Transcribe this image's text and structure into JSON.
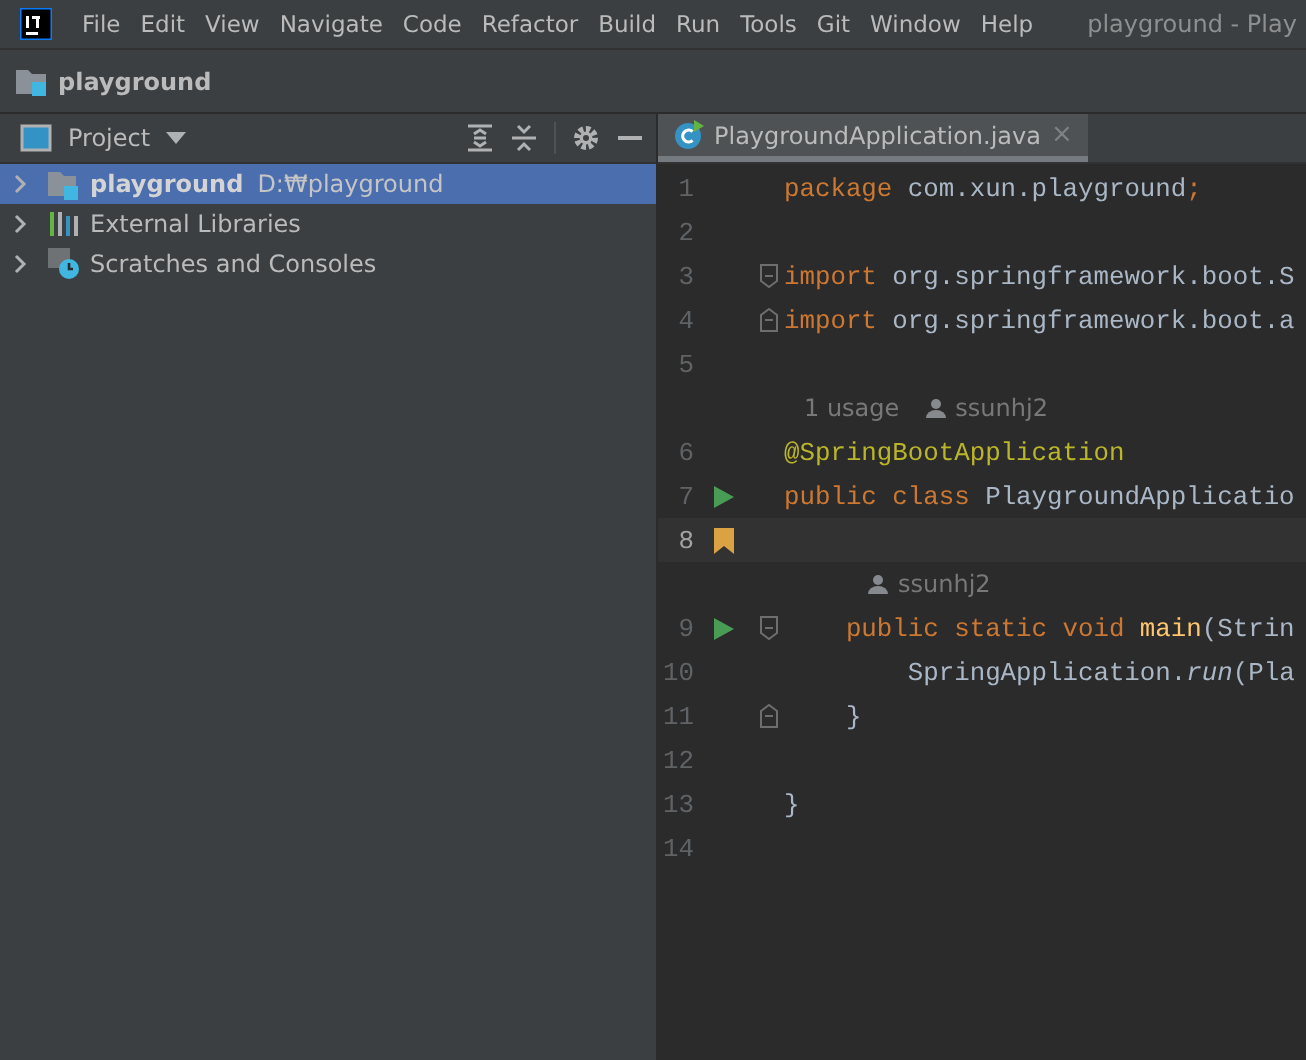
{
  "menu_bar": {
    "items": [
      "File",
      "Edit",
      "View",
      "Navigate",
      "Code",
      "Refactor",
      "Build",
      "Run",
      "Tools",
      "Git",
      "Window",
      "Help"
    ],
    "window_title": "playground - Play"
  },
  "navigation_bar": {
    "crumb": "playground"
  },
  "project_panel": {
    "title": "Project",
    "items": [
      {
        "kind": "module",
        "label": "playground",
        "path": "D:₩playground",
        "selected": true,
        "expanded": false
      },
      {
        "kind": "libraries",
        "label": "External Libraries",
        "selected": false,
        "expanded": false
      },
      {
        "kind": "scratches",
        "label": "Scratches and Consoles",
        "selected": false,
        "expanded": false
      }
    ]
  },
  "editor": {
    "tabs": [
      {
        "label": "PlaygroundApplication.java",
        "selected": true,
        "close": "×"
      }
    ],
    "lines": [
      {
        "kind": "code",
        "number": "1",
        "tokens": [
          {
            "kind": "keyword",
            "text": "package"
          },
          {
            "kind": "plain",
            "text": " com.xun.playground"
          },
          {
            "kind": "keyword",
            "text": ";"
          }
        ]
      },
      {
        "kind": "code",
        "number": "2"
      },
      {
        "kind": "code",
        "number": "3",
        "fold_start": true,
        "tokens": [
          {
            "kind": "keyword",
            "text": "import"
          },
          {
            "kind": "plain",
            "text": " org.springframework.boot.S"
          }
        ]
      },
      {
        "kind": "code",
        "number": "4",
        "fold_end": true,
        "tokens": [
          {
            "kind": "keyword",
            "text": "import"
          },
          {
            "kind": "plain",
            "text": " org.springframework.boot.a"
          }
        ]
      },
      {
        "kind": "code",
        "number": "5"
      },
      {
        "kind": "hint",
        "indent": false,
        "usage": "1 usage",
        "author": "ssunhj2"
      },
      {
        "kind": "code",
        "number": "6",
        "tokens": [
          {
            "kind": "annotation",
            "text": "@SpringBootApplication"
          }
        ]
      },
      {
        "kind": "code",
        "number": "7",
        "run": true,
        "tokens": [
          {
            "kind": "keyword",
            "text": "public class "
          },
          {
            "kind": "plain",
            "text": "PlaygroundApplicatio"
          }
        ]
      },
      {
        "kind": "code",
        "number": "8",
        "bookmark": true,
        "current": true
      },
      {
        "kind": "hint",
        "indent": true,
        "author": "ssunhj2"
      },
      {
        "kind": "code",
        "number": "9",
        "run": true,
        "fold_start": true,
        "tokens": [
          {
            "kind": "keyword",
            "text": "    public static void "
          },
          {
            "kind": "method",
            "text": "main"
          },
          {
            "kind": "plain",
            "text": "(Strin"
          }
        ]
      },
      {
        "kind": "code",
        "number": "10",
        "tokens": [
          {
            "kind": "plain",
            "text": "        SpringApplication."
          },
          {
            "kind": "italic",
            "text": "run"
          },
          {
            "kind": "plain",
            "text": "(Pla"
          }
        ]
      },
      {
        "kind": "code",
        "number": "11",
        "fold_end": true,
        "tokens": [
          {
            "kind": "plain",
            "text": "    }"
          }
        ]
      },
      {
        "kind": "code",
        "number": "12"
      },
      {
        "kind": "code",
        "number": "13",
        "tokens": [
          {
            "kind": "plain",
            "text": "}"
          }
        ]
      },
      {
        "kind": "code",
        "number": "14"
      }
    ]
  }
}
